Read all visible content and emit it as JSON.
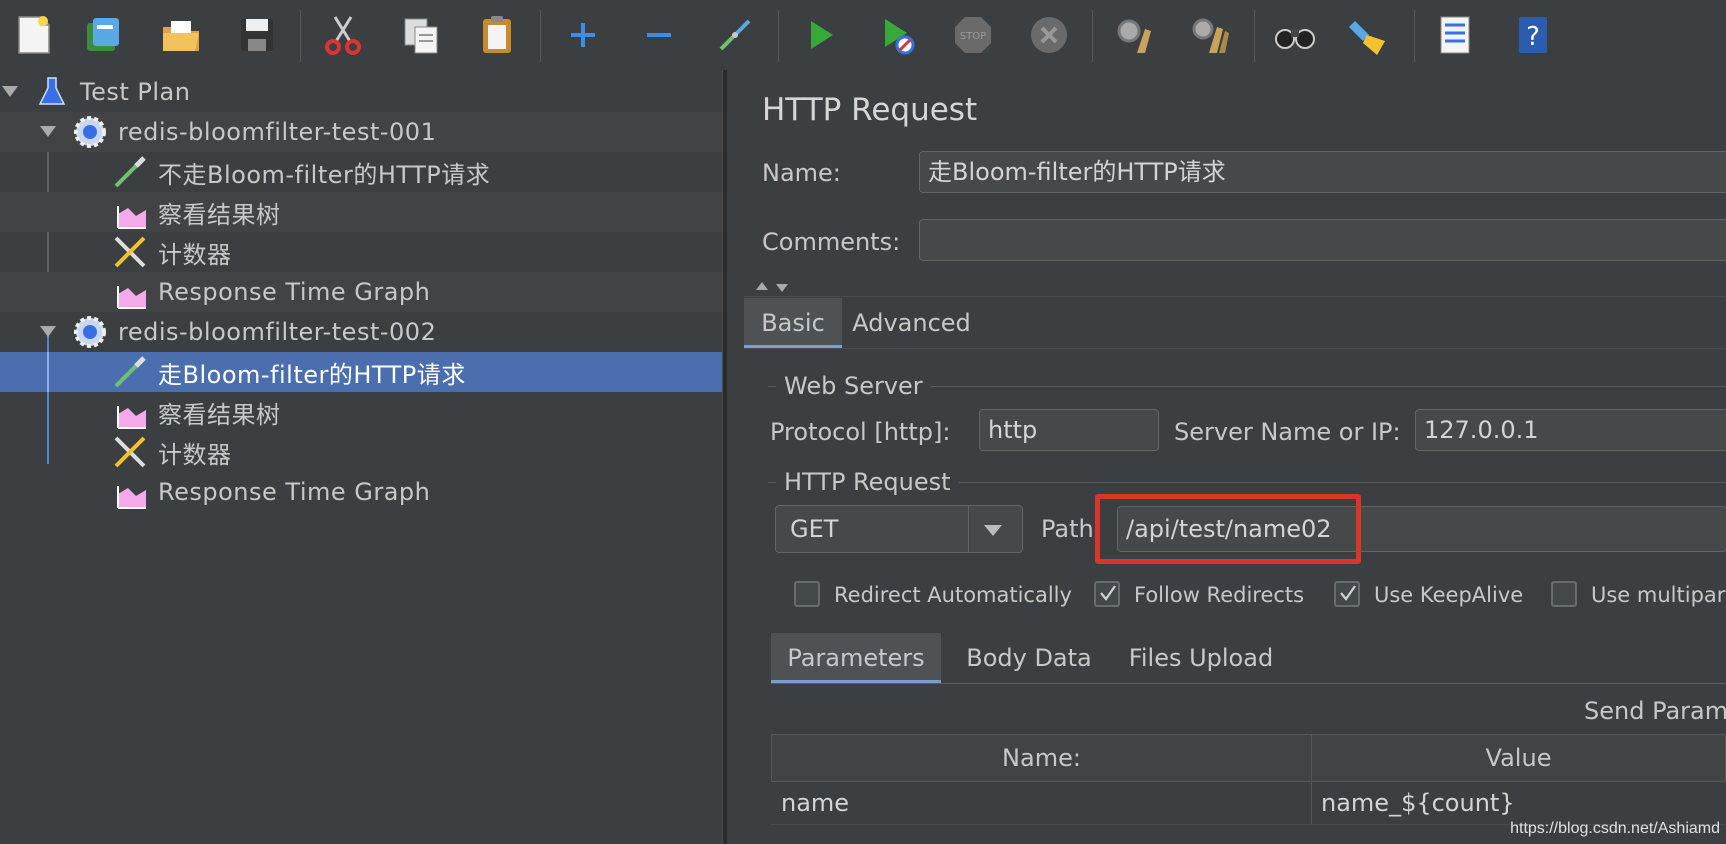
{
  "tree": {
    "root": "Test Plan",
    "groups": [
      {
        "label": "redis-bloomfilter-test-001",
        "children": [
          "不走Bloom-filter的HTTP请求",
          "察看结果树",
          "计数器",
          "Response Time Graph"
        ]
      },
      {
        "label": "redis-bloomfilter-test-002",
        "children": [
          "走Bloom-filter的HTTP请求",
          "察看结果树",
          "计数器",
          "Response Time Graph"
        ]
      }
    ],
    "selected": "走Bloom-filter的HTTP请求"
  },
  "panel": {
    "title": "HTTP Request",
    "name_label": "Name:",
    "name_value": "走Bloom-filter的HTTP请求",
    "comments_label": "Comments:",
    "comments_value": "",
    "tabs": [
      "Basic",
      "Advanced"
    ],
    "web_server": {
      "legend": "Web Server",
      "protocol_label": "Protocol [http]:",
      "protocol_value": "http",
      "server_label": "Server Name or IP:",
      "server_value": "127.0.0.1"
    },
    "http_request": {
      "legend": "HTTP Request",
      "method": "GET",
      "path_label": "Path",
      "path_value": "/api/test/name02"
    },
    "options": [
      {
        "label": "Redirect Automatically",
        "checked": false
      },
      {
        "label": "Follow Redirects",
        "checked": true
      },
      {
        "label": "Use KeepAlive",
        "checked": true
      },
      {
        "label": "Use multipart",
        "checked": false
      }
    ],
    "sub_tabs": [
      "Parameters",
      "Body Data",
      "Files Upload"
    ],
    "send_params_label": "Send Param",
    "table": {
      "headers": [
        "Name:",
        "Value"
      ],
      "rows": [
        [
          "name",
          "name_${count}"
        ]
      ]
    }
  },
  "watermark": "https://blog.csdn.net/Ashiamd",
  "colors": {
    "selection": "#4b6eaf",
    "highlight_box": "#d9362b",
    "background": "#3c3f41"
  }
}
